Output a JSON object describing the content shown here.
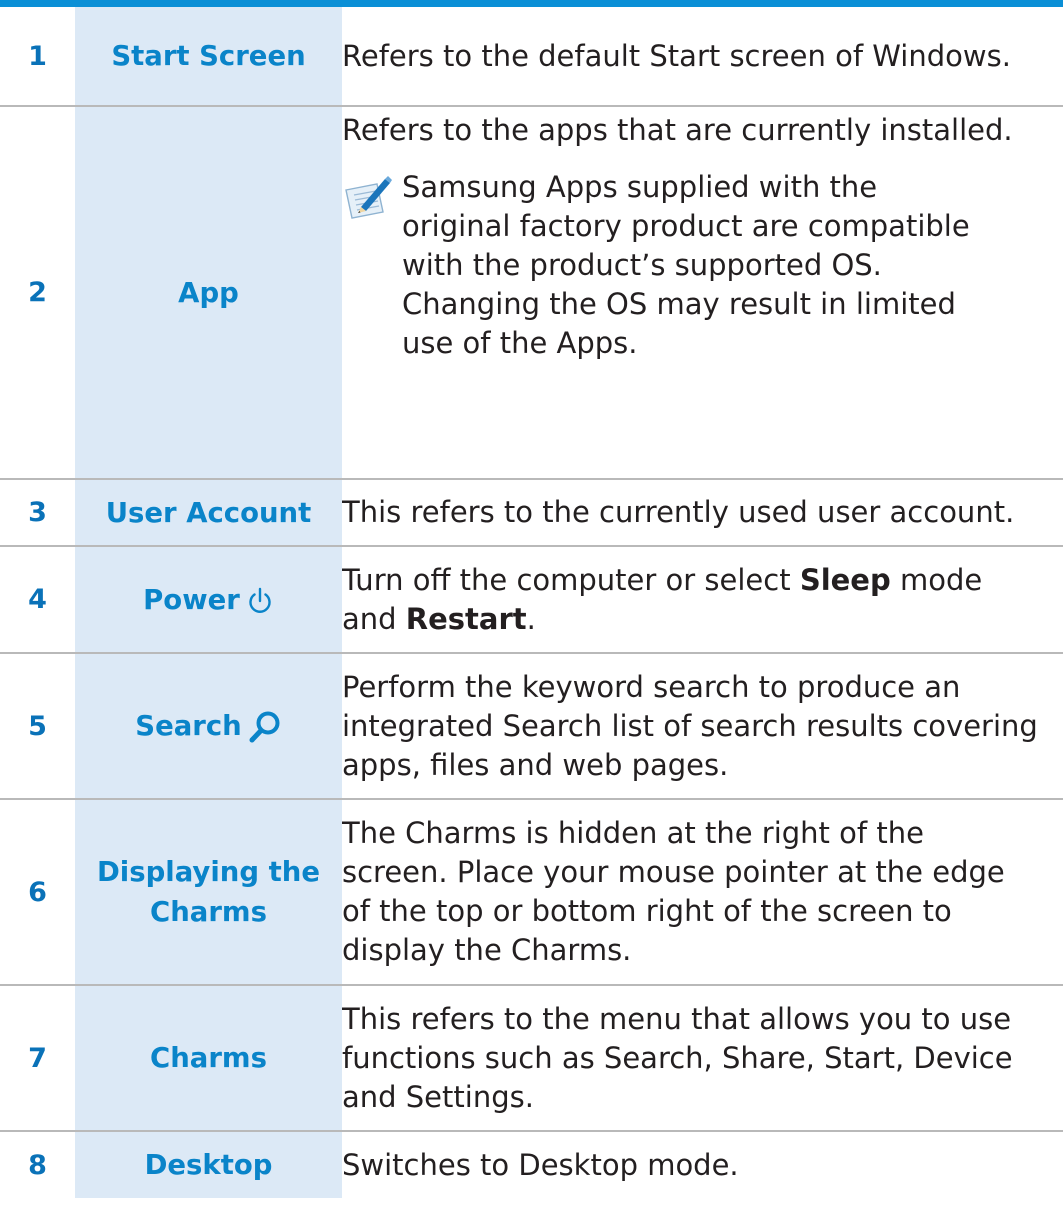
{
  "rows": [
    {
      "number": "1",
      "name": "Start Screen",
      "desc": [
        "Refers to the default Start screen of Windows."
      ]
    },
    {
      "number": "2",
      "name": "App",
      "desc": [
        "Refers to the apps that are currently installed."
      ],
      "note": [
        "Samsung Apps supplied with the",
        "original factory product are compatible",
        "with the product’s supported OS.",
        "Changing the OS may result in limited",
        "use of the Apps."
      ]
    },
    {
      "number": "3",
      "name": "User Account",
      "desc": [
        "This refers to the currently used user account."
      ]
    },
    {
      "number": "4",
      "name": "Power",
      "icon": "power-icon",
      "desc_a": "Turn off the computer or select ",
      "desc_b": "Sleep",
      "desc_c": " mode",
      "desc_d": "and ",
      "desc_e": "Restart",
      "desc_f": "."
    },
    {
      "number": "5",
      "name": "Search",
      "icon": "search-icon",
      "desc": [
        "Perform the keyword search to produce an",
        "integrated Search list of search results covering",
        "apps, files and web pages."
      ]
    },
    {
      "number": "6",
      "name": [
        "Displaying the",
        "Charms"
      ],
      "desc": [
        "The Charms is hidden at the right of the",
        "screen. Place your mouse pointer at the edge",
        "of the top or bottom right of the screen to",
        "display the Charms."
      ]
    },
    {
      "number": "7",
      "name": "Charms",
      "desc": [
        "This refers to the menu that allows you to use",
        "functions such as Search, Share, Start, Device",
        "and Settings."
      ]
    },
    {
      "number": "8",
      "name": "Desktop",
      "desc": [
        "Switches to Desktop mode."
      ]
    }
  ],
  "colors": {
    "accent_blue": "#0a84c9",
    "number_blue": "#0a72b8",
    "name_cell_bg": "#dce9f6",
    "top_rule": "#0a8fd6",
    "divider": "#b9b9b9",
    "body_text": "#231f20"
  }
}
